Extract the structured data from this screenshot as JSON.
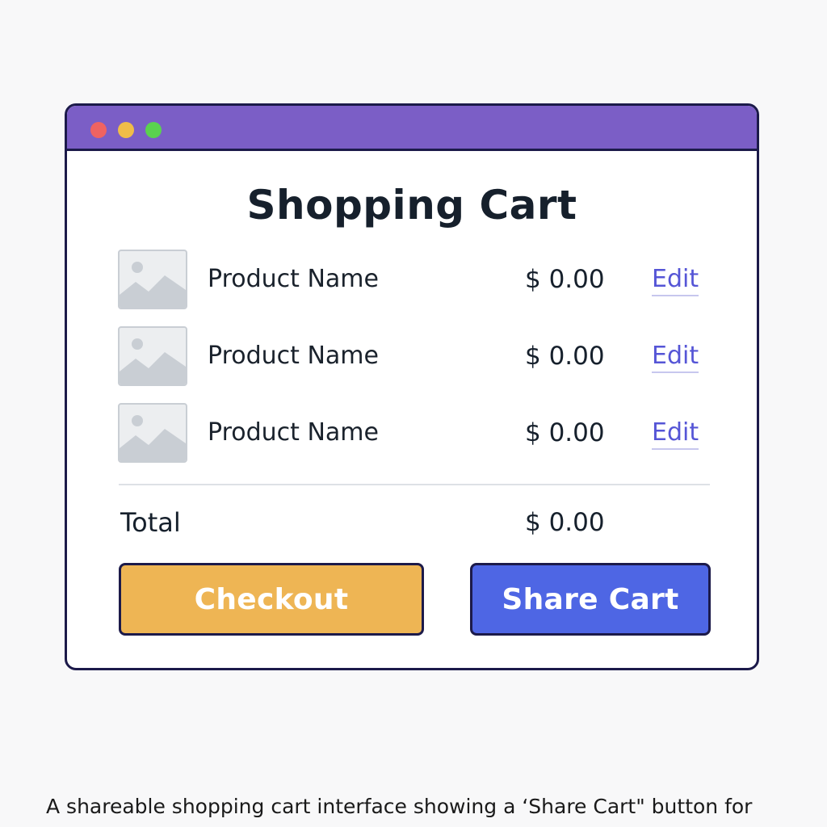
{
  "window": {
    "controls": [
      "close",
      "minimize",
      "maximize"
    ]
  },
  "cart": {
    "title": "Shopping Cart",
    "items": [
      {
        "name": "Product Name",
        "price": "$ 0.00",
        "action": "Edit"
      },
      {
        "name": "Product Name",
        "price": "$ 0.00",
        "action": "Edit"
      },
      {
        "name": "Product Name",
        "price": "$ 0.00",
        "action": "Edit"
      }
    ],
    "total_label": "Total",
    "total_value": "$ 0.00",
    "checkout_label": "Checkout",
    "share_label": "Share Cart"
  },
  "caption": "A shareable shopping cart interface showing a ‘Share Cart\" button for",
  "icons": {
    "thumbnail": "image-placeholder-icon"
  },
  "colors": {
    "titlebar": "#7b5ec6",
    "checkout": "#eeb554",
    "share": "#4e66e4",
    "link": "#5555d6",
    "close_dot": "#ef6361",
    "minimize_dot": "#f0bd48",
    "maximize_dot": "#5ad24f"
  }
}
